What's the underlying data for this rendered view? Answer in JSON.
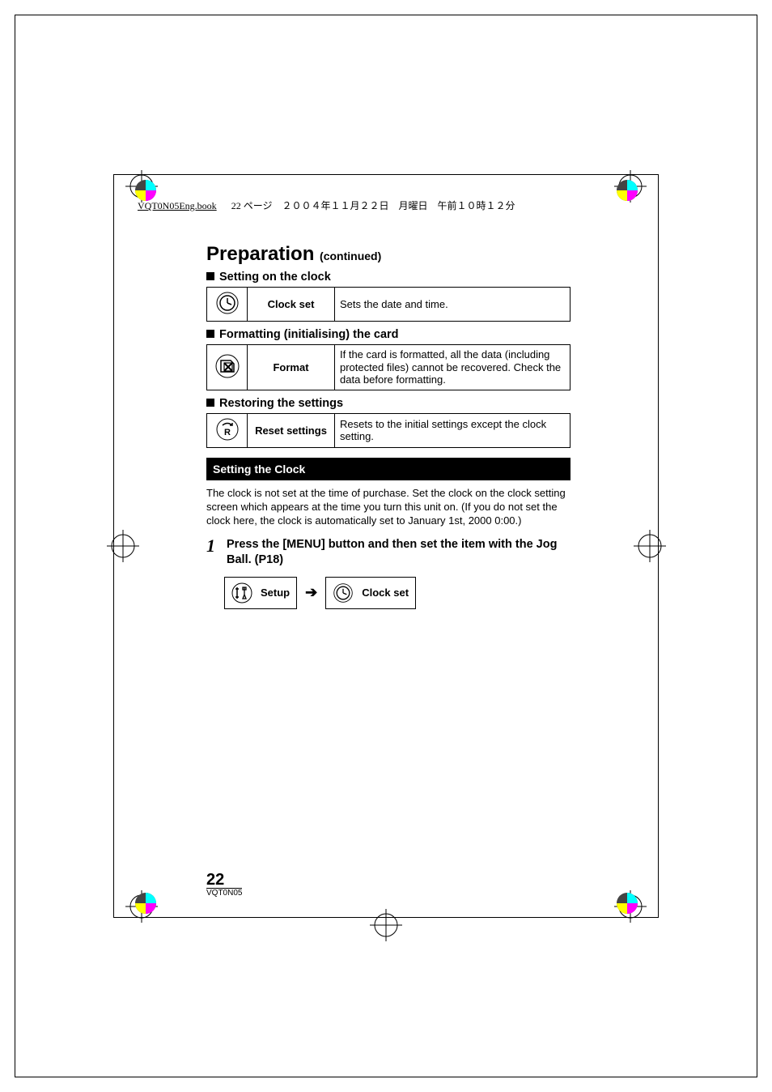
{
  "print_header": {
    "file": "VQT0N05Eng.book",
    "rest": "22 ページ　２００４年１１月２２日　月曜日　午前１０時１２分"
  },
  "title": "Preparation",
  "title_continued": "(continued)",
  "sections": {
    "clock": {
      "heading": "Setting on the clock",
      "label": "Clock set",
      "desc": "Sets the date and time."
    },
    "format": {
      "heading": "Formatting (initialising) the card",
      "label": "Format",
      "desc": "If the card is formatted, all the data (including protected files) cannot be recovered. Check the data before formatting."
    },
    "reset": {
      "heading": "Restoring the settings",
      "label": "Reset settings",
      "desc": "Resets to the initial settings except the clock setting."
    }
  },
  "bar_title": "Setting the Clock",
  "body_text": "The clock is not set at the time of purchase. Set the clock on the clock setting screen which appears at the time you turn this unit on. (If you do not set the clock here, the clock is automatically set to January 1st, 2000 0:00.)",
  "step1": {
    "num": "1",
    "text": "Press the [MENU] button and then set the item with the Jog Ball. (P18)",
    "nav1": "Setup",
    "nav2": "Clock set"
  },
  "page_num": "22",
  "doc_code": "VQT0N05"
}
